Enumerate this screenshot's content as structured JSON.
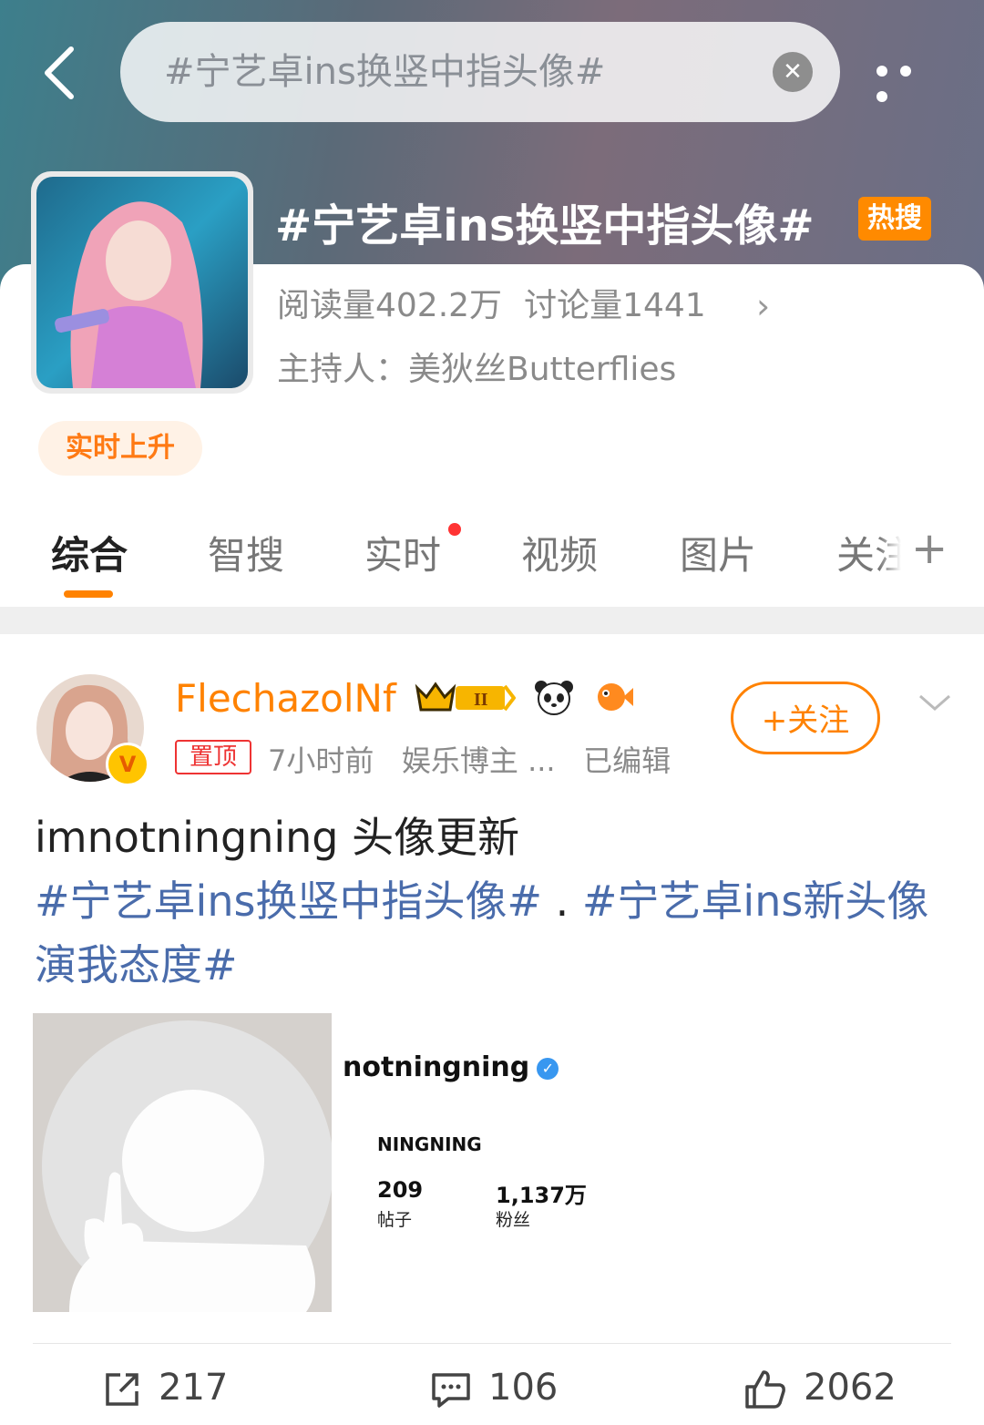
{
  "search": {
    "query": "#宁艺卓ins换竖中指头像#"
  },
  "topic": {
    "title": "#宁艺卓ins换竖中指头像#",
    "badge": "热搜",
    "read_count": "阅读量402.2万",
    "discuss_count": "讨论量1441",
    "host": "主持人：美狄丝Butterflies",
    "rise_tag": "实时上升"
  },
  "tabs": [
    {
      "label": "综合",
      "active": true
    },
    {
      "label": "智搜"
    },
    {
      "label": "实时",
      "dot": true
    },
    {
      "label": "视频"
    },
    {
      "label": "图片"
    },
    {
      "label": "关注"
    }
  ],
  "post": {
    "username": "FlechazolNf",
    "pin": "置顶",
    "time": "7小时前",
    "category": "娱乐博主 ...",
    "edited": "已编辑",
    "follow_label": "+关注",
    "text_plain": "imnotningning 头像更新",
    "topic1": "#宁艺卓ins换竖中指头像#",
    "separator": " . ",
    "topic2": "#宁艺卓ins新头像演我态度#",
    "image": {
      "handle": "notningning",
      "name": "NINGNING",
      "posts_num": "209",
      "posts_label": "帖子",
      "followers_num": "1,137万",
      "followers_label": "粉丝"
    },
    "reposts": "217",
    "comments": "106",
    "likes": "2062"
  },
  "colors": {
    "accent": "#ff8200",
    "link": "#4a6cab",
    "hot": "#ff8a00"
  }
}
